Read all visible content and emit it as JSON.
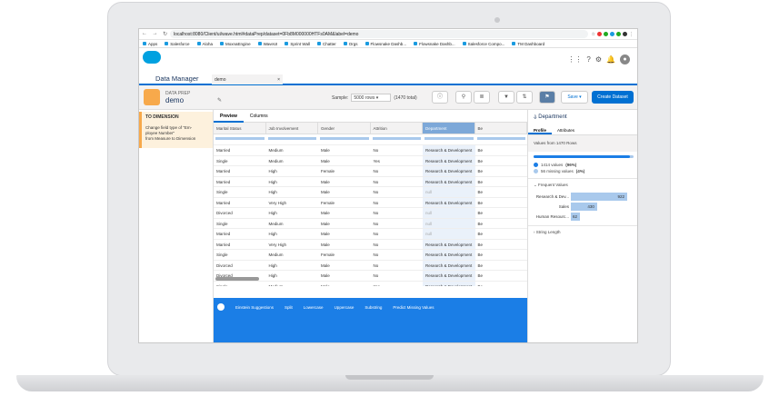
{
  "browser": {
    "url": "localhost:8080/Client/ui/wave.html#dataPrep/dataset=0Fb8M000000HTFs0AM&label=demo",
    "bookmarks": [
      "Apps",
      "Salesforce",
      "Aloha",
      "MoxnaEngine",
      "WaveUI",
      "Sprint Wall",
      "Chatter",
      "Orgs",
      "Flowsnake Dashb...",
      "Flowsnake Dashb...",
      "Salesforce Compo...",
      "TM Dashboard"
    ]
  },
  "app": {
    "name": "Data Manager",
    "tab": "demo"
  },
  "toolbar": {
    "type": "DATA PREP",
    "name": "demo",
    "sample_label": "Sample:",
    "sample_value": "5000 rows",
    "total": "(1470 total)",
    "save": "Save",
    "create": "Create Dataset"
  },
  "left_panel": {
    "title": "TO DIMENSION",
    "line1": "Change field type of \"Em-",
    "line2": "ployee Number\"",
    "line3": "from Measure to Dimension"
  },
  "main": {
    "tabs": [
      "Preview",
      "Columns"
    ],
    "columns": [
      "Marital Status",
      "Job Involvement",
      "Gender",
      "Attrition",
      "Department",
      "Be"
    ],
    "rows": [
      [
        "Married",
        "Medium",
        "Male",
        "No",
        "Research & Development",
        "Be"
      ],
      [
        "Single",
        "Medium",
        "Male",
        "Yes",
        "Research & Development",
        "Be"
      ],
      [
        "Married",
        "High",
        "Female",
        "No",
        "Research & Development",
        "Be"
      ],
      [
        "Married",
        "High",
        "Male",
        "No",
        "Research & Development",
        "Be"
      ],
      [
        "Single",
        "High",
        "Male",
        "No",
        "null",
        "Be"
      ],
      [
        "Married",
        "Very High",
        "Female",
        "No",
        "Research & Development",
        "Be"
      ],
      [
        "Divorced",
        "High",
        "Male",
        "No",
        "null",
        "Be"
      ],
      [
        "Single",
        "Medium",
        "Male",
        "No",
        "null",
        "Be"
      ],
      [
        "Married",
        "High",
        "Male",
        "No",
        "null",
        "Be"
      ],
      [
        "Married",
        "Very High",
        "Male",
        "No",
        "Research & Development",
        "Be"
      ],
      [
        "Single",
        "Medium",
        "Female",
        "No",
        "Research & Development",
        "Be"
      ],
      [
        "Divorced",
        "High",
        "Male",
        "No",
        "Research & Development",
        "Be"
      ],
      [
        "Divorced",
        "High",
        "Male",
        "No",
        "Research & Development",
        "Be"
      ],
      [
        "Single",
        "Medium",
        "Male",
        "Yes",
        "Research & Development",
        "Be"
      ]
    ],
    "suggestions": [
      "Einstein Suggestions",
      "Split",
      "Lowercase",
      "Uppercase",
      "Substring",
      "Predict Missing Values"
    ]
  },
  "right_panel": {
    "title": "Department",
    "tabs": [
      "Profile",
      "Attributes"
    ],
    "summary": "Values from 1470 Rows",
    "values_label": "1414 values",
    "values_pct": "(96%)",
    "missing_label": "56 missing values",
    "missing_pct": "(4%)",
    "fill": 0.96,
    "frequent_title": "Frequent Values",
    "string_length": "String Length",
    "frequent": [
      {
        "label": "Research & Dev...",
        "count": 922
      },
      {
        "label": "Sales",
        "count": 430
      },
      {
        "label": "Human Resourc...",
        "count": 62
      }
    ]
  }
}
